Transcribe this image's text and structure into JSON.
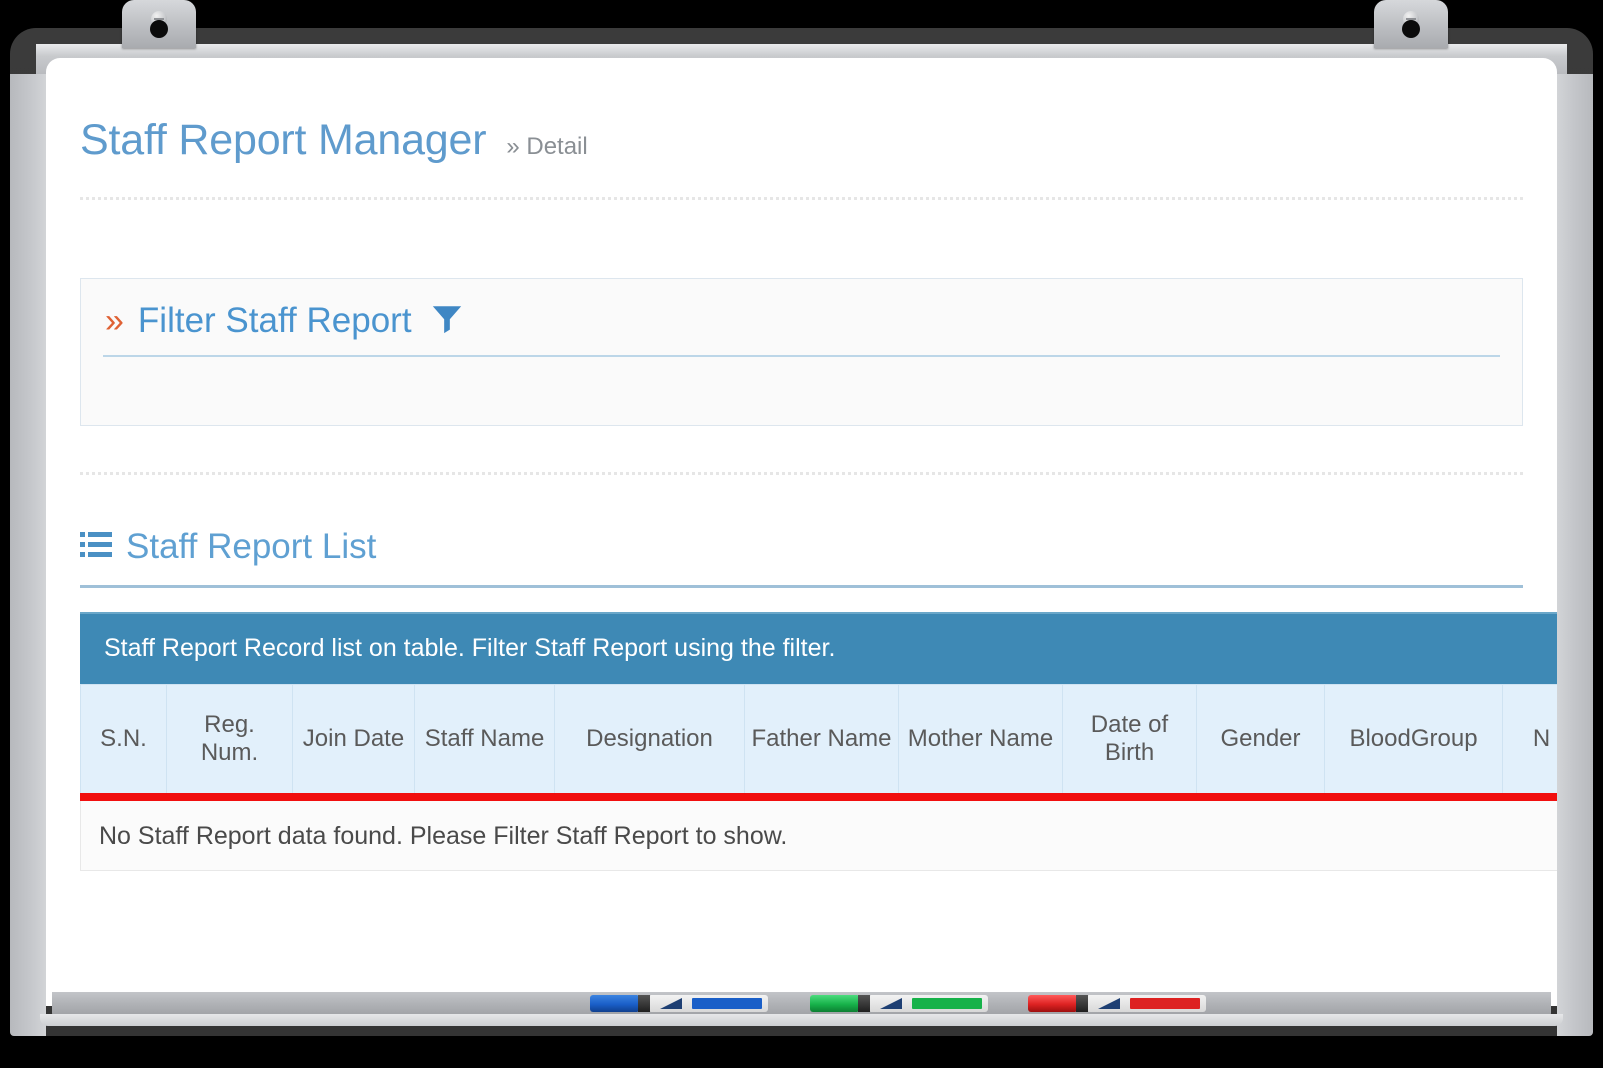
{
  "header": {
    "title": "Staff Report Manager",
    "breadcrumb_chevron": "»",
    "breadcrumb": "Detail"
  },
  "filter_panel": {
    "chevron": "»",
    "title": "Filter Staff Report",
    "icon": "funnel-icon"
  },
  "list_section": {
    "icon": "th-list-icon",
    "heading": "Staff Report List",
    "banner": "Staff Report Record list on table. Filter Staff Report using the filter.",
    "columns": [
      "S.N.",
      "Reg. Num.",
      "Join Date",
      "Staff Name",
      "Designation",
      "Father Name",
      "Mother Name",
      "Date of Birth",
      "Gender",
      "BloodGroup",
      "N"
    ],
    "empty_message": "No Staff Report data found. Please Filter Staff Report to show.",
    "rows": []
  },
  "whiteboard": {
    "markers": [
      {
        "name": "blue-marker",
        "color": "#1a5fc8",
        "cap": "#1f6fd4"
      },
      {
        "name": "green-marker",
        "color": "#17b24a",
        "cap": "#17b24a"
      },
      {
        "name": "red-marker",
        "color": "#dd2222",
        "cap": "#dd2222"
      }
    ]
  },
  "colors": {
    "title_blue": "#5f9bcd",
    "banner_blue": "#3e89b5",
    "table_header_blue": "#e2f0fb",
    "accent_orange": "#df6134",
    "rule_red": "#f10f0f"
  }
}
